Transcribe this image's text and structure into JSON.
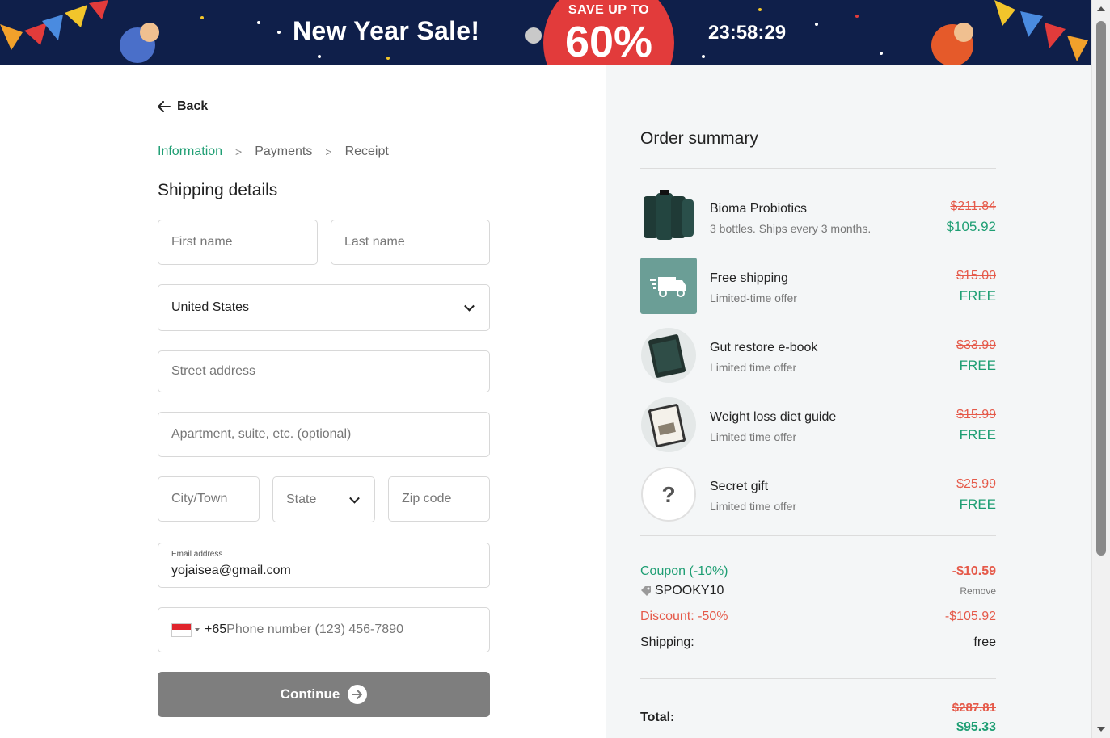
{
  "banner": {
    "title": "New Year Sale!",
    "save_text": "SAVE UP TO",
    "save_percent": "60%",
    "countdown": "23:58:29"
  },
  "nav": {
    "back_label": "Back"
  },
  "breadcrumb": {
    "items": [
      "Information",
      "Payments",
      "Receipt"
    ],
    "active_index": 0
  },
  "shipping": {
    "title": "Shipping details",
    "first_name_placeholder": "First name",
    "last_name_placeholder": "Last name",
    "country_value": "United States",
    "street_placeholder": "Street address",
    "apartment_placeholder": "Apartment, suite, etc. (optional)",
    "city_placeholder": "City/Town",
    "state_value": "State",
    "zip_placeholder": "Zip code",
    "email_label": "Email address",
    "email_value": "yojaisea@gmail.com",
    "phone_dial_code": "+65",
    "phone_placeholder": "Phone number (123) 456-7890",
    "continue_label": "Continue"
  },
  "summary": {
    "title": "Order summary",
    "items": [
      {
        "name": "Bioma Probiotics",
        "sub": "3 bottles. Ships every 3 months.",
        "old_price": "$211.84",
        "new_price": "$105.92",
        "icon": "bottles-icon"
      },
      {
        "name": "Free shipping",
        "sub": "Limited-time offer",
        "old_price": "$15.00",
        "new_price": "FREE",
        "icon": "truck-icon"
      },
      {
        "name": "Gut restore e-book",
        "sub": "Limited time offer",
        "old_price": "$33.99",
        "new_price": "FREE",
        "icon": "ebook-icon"
      },
      {
        "name": "Weight loss diet guide",
        "sub": "Limited time offer",
        "old_price": "$15.99",
        "new_price": "FREE",
        "icon": "guide-icon"
      },
      {
        "name": "Secret gift",
        "sub": "Limited time offer",
        "old_price": "$25.99",
        "new_price": "FREE",
        "icon": "question-icon"
      }
    ],
    "coupon_label": "Coupon (-10%)",
    "coupon_amount": "-$10.59",
    "coupon_code": "SPOOKY10",
    "remove_label": "Remove",
    "discount_label": "Discount: -50%",
    "discount_amount": "-$105.92",
    "shipping_label": "Shipping:",
    "shipping_value": "free",
    "total_label": "Total:",
    "total_old": "$287.81",
    "total_new": "$95.33"
  },
  "colors": {
    "accent_green": "#1e9e73",
    "price_red": "#e55a4a",
    "banner_navy": "#0f1f4a",
    "badge_red": "#e23b3b",
    "button_gray": "#7e7e7e"
  }
}
